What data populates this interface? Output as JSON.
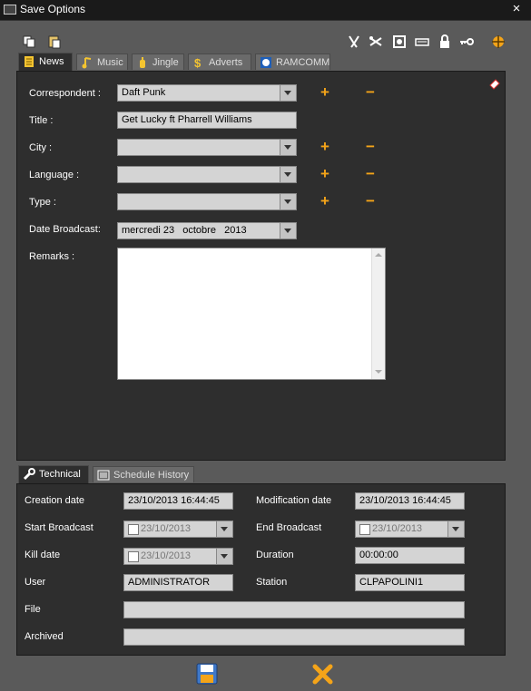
{
  "window": {
    "title": "Save Options",
    "close_glyph": "×"
  },
  "toolbar": {
    "left_icons": [
      "copy-icon",
      "paste-icon"
    ],
    "right_icons": [
      "scissors-icon",
      "cut-icon",
      "target-icon",
      "keyboard-icon",
      "lock-icon",
      "key-icon",
      "crosshair-icon"
    ]
  },
  "top_tabs": [
    {
      "label": "News",
      "icon": "news-icon",
      "active": true
    },
    {
      "label": "Music",
      "icon": "music-note-icon",
      "active": false
    },
    {
      "label": "Jingle",
      "icon": "jingle-icon",
      "active": false
    },
    {
      "label": "Adverts",
      "icon": "dollar-icon",
      "active": false
    },
    {
      "label": "RAMCOMM",
      "icon": "ramcomm-icon",
      "active": false
    }
  ],
  "news": {
    "correspondent": {
      "label": "Correspondent :",
      "value": "Daft Punk"
    },
    "title": {
      "label": "Title :",
      "value": "Get Lucky ft Pharrell Williams"
    },
    "city": {
      "label": "City :",
      "value": ""
    },
    "language": {
      "label": "Language :",
      "value": ""
    },
    "type": {
      "label": "Type :",
      "value": ""
    },
    "date_broadcast": {
      "label": "Date Broadcast:",
      "value": "mercredi 23   octobre   2013"
    },
    "remarks": {
      "label": "Remarks :",
      "value": ""
    },
    "plus_glyph": "+",
    "minus_glyph": "−"
  },
  "bottom_tabs": [
    {
      "label": "Technical",
      "icon": "wrench-icon",
      "active": true
    },
    {
      "label": "Schedule History",
      "icon": "list-icon",
      "active": false
    }
  ],
  "technical": {
    "creation_date": {
      "label": "Creation date",
      "value": "23/10/2013 16:44:45"
    },
    "modification_date": {
      "label": "Modification date",
      "value": "23/10/2013 16:44:45"
    },
    "start_broadcast": {
      "label": "Start Broadcast",
      "value": "23/10/2013"
    },
    "end_broadcast": {
      "label": "End Broadcast",
      "value": "23/10/2013"
    },
    "kill_date": {
      "label": "Kill date",
      "value": "23/10/2013"
    },
    "duration": {
      "label": "Duration",
      "value": "00:00:00"
    },
    "user": {
      "label": "User",
      "value": "ADMINISTRATOR"
    },
    "station": {
      "label": "Station",
      "value": "CLPAPOLINI1"
    },
    "file": {
      "label": "File",
      "value": ""
    },
    "archived": {
      "label": "Archived",
      "value": ""
    }
  },
  "footer": {
    "save_icon": "floppy-disk-icon",
    "cancel_icon": "cancel-x-icon"
  },
  "colors": {
    "accent": "#f4a419",
    "panel": "#2e2e2e",
    "frame": "#5a5a5a",
    "field": "#d4d4d4"
  }
}
